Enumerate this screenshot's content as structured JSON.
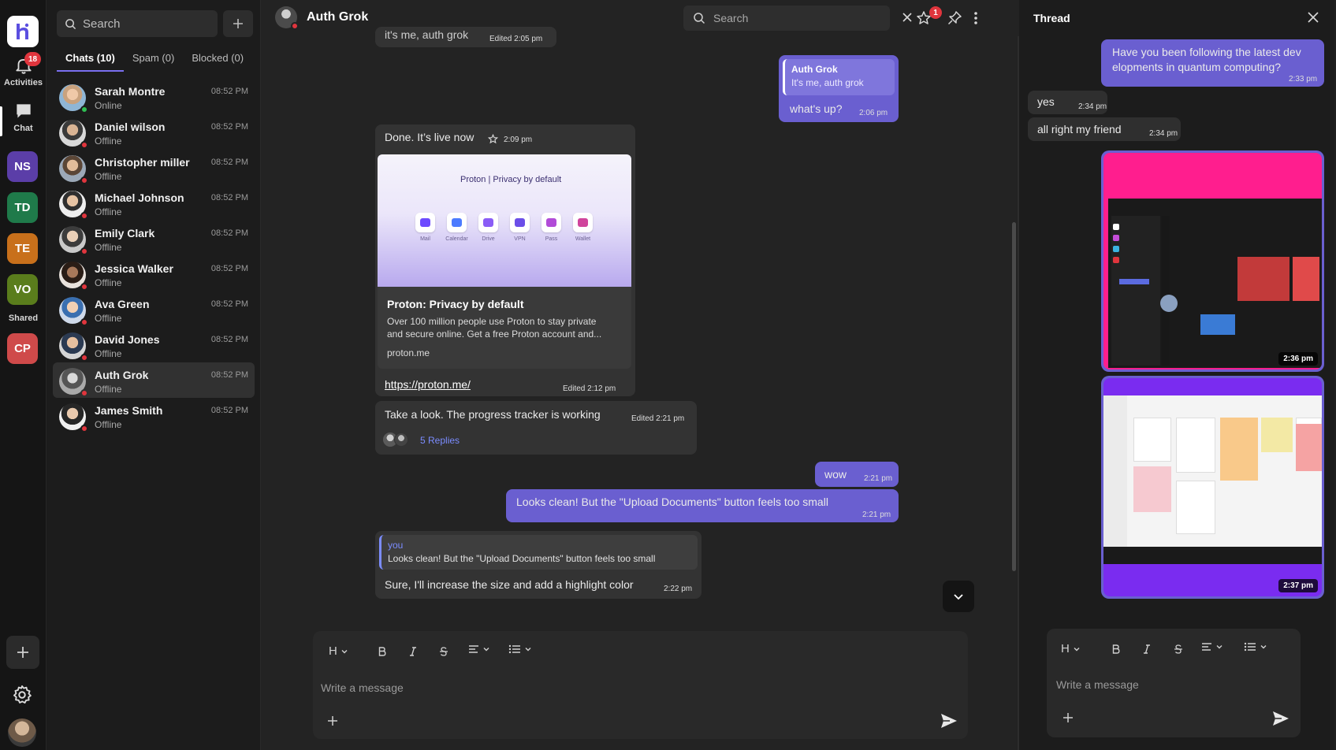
{
  "rail": {
    "activities_label": "Activities",
    "activities_badge": "18",
    "chat_label": "Chat",
    "workspaces": [
      {
        "initials": "NS",
        "color": "#5b3ea8"
      },
      {
        "initials": "TD",
        "color": "#1f7a4a"
      },
      {
        "initials": "TE",
        "color": "#c8701b"
      },
      {
        "initials": "VO",
        "color": "#5a7d1c"
      },
      {
        "initials": "CP",
        "color": "#cf4a4a"
      }
    ],
    "shared_label": "Shared"
  },
  "sidebar": {
    "search_placeholder": "Search",
    "tabs": [
      {
        "label": "Chats (10)"
      },
      {
        "label": "Spam (0)"
      },
      {
        "label": "Blocked (0)"
      }
    ],
    "chats": [
      {
        "name": "Sarah Montre",
        "status": "Online",
        "time": "08:52 PM",
        "status_color": "#2fbf53"
      },
      {
        "name": "Daniel wilson",
        "status": "Offline",
        "time": "08:52 PM",
        "status_color": "#e0353d"
      },
      {
        "name": "Christopher miller",
        "status": "Offline",
        "time": "08:52 PM",
        "status_color": "#e0353d"
      },
      {
        "name": "Michael Johnson",
        "status": "Offline",
        "time": "08:52 PM",
        "status_color": "#e0353d"
      },
      {
        "name": "Emily Clark",
        "status": "Offline",
        "time": "08:52 PM",
        "status_color": "#e0353d"
      },
      {
        "name": "Jessica Walker",
        "status": "Offline",
        "time": "08:52 PM",
        "status_color": "#e0353d"
      },
      {
        "name": "Ava Green",
        "status": "Offline",
        "time": "08:52 PM",
        "status_color": "#e0353d"
      },
      {
        "name": "David Jones",
        "status": "Offline",
        "time": "08:52 PM",
        "status_color": "#e0353d"
      },
      {
        "name": "Auth Grok",
        "status": "Offline",
        "time": "08:52 PM",
        "status_color": "#e0353d"
      },
      {
        "name": "James Smith",
        "status": "Offline",
        "time": "08:52 PM",
        "status_color": "#e0353d"
      }
    ]
  },
  "header": {
    "title": "Auth Grok",
    "search_placeholder": "Search",
    "starred_badge": "1"
  },
  "messages": {
    "m0_text": "it's me, auth grok",
    "m0_time": "Edited  2:05 pm",
    "m1_reply_name": "Auth Grok",
    "m1_reply_text": "It's me, auth grok",
    "m1_text": "what's up?",
    "m1_time": "2:06 pm",
    "m2_text": "Done. It’s live now",
    "m2_time": "2:09 pm",
    "card_logo": "Proton  |  Privacy by default",
    "card_apps": [
      "Mail",
      "Calendar",
      "Drive",
      "VPN",
      "Pass",
      "Wallet"
    ],
    "card_title": "Proton: Privacy by default",
    "card_desc_1": "Over 100 million people use Proton to stay private",
    "card_desc_2": "and secure online. Get a free Proton account and...",
    "card_domain": "proton.me",
    "card_link": "https://proton.me/",
    "card_time": "Edited  2:12 pm",
    "m3_text": "Take a look. The progress tracker is working",
    "m3_time": "Edited  2:21 pm",
    "m3_replies": "5 Replies",
    "m4_text": "wow",
    "m4_time": "2:21 pm",
    "m5_text": "Looks clean! But the \"Upload Documents\" button feels too small",
    "m5_time": "2:21 pm",
    "m6_reply_name": "you",
    "m6_reply_text": "Looks clean! But the \"Upload Documents\" button feels too small",
    "m6_text": "Sure, I'll increase the size and add a highlight color",
    "m6_time": "2:22 pm"
  },
  "composer": {
    "placeholder": "Write a message",
    "heading_label": "H"
  },
  "thread": {
    "title": "Thread",
    "t1_text_1": "Have you been following the latest dev",
    "t1_text_2": "elopments in quantum computing?",
    "t1_time": "2:33 pm",
    "t2_text": "yes",
    "t2_time": "2:34 pm",
    "t3_text": "all right my friend",
    "t3_time": "2:34 pm",
    "img1_time": "2:36 pm",
    "img2_time": "2:37 pm",
    "composer_placeholder": "Write a message",
    "heading_label": "H"
  }
}
